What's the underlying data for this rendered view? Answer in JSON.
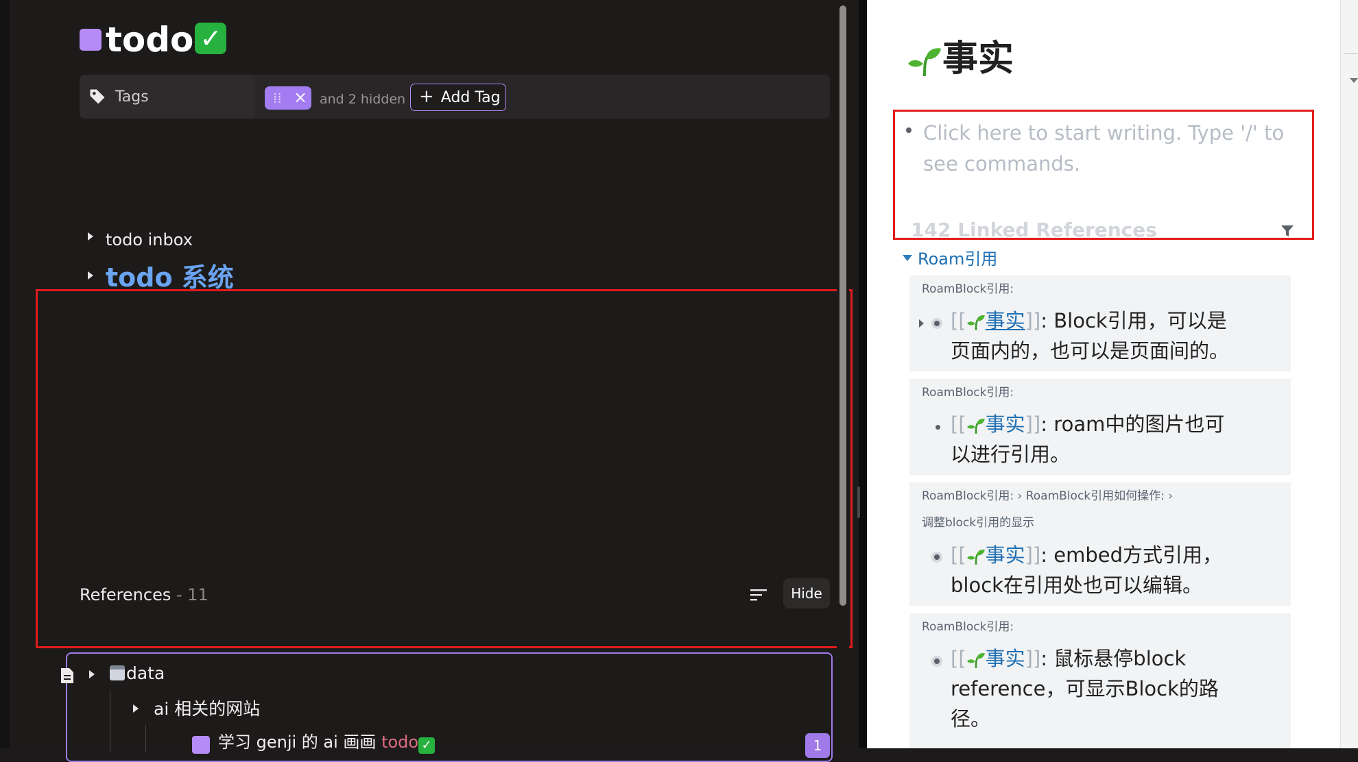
{
  "left": {
    "title": "todo",
    "title_check": "✓",
    "tags": {
      "label": "Tags",
      "chip_text": "⁞⁞",
      "chip_close": "×",
      "hidden_text": "and 2 hidden",
      "add_plus": "+",
      "add_label": "Add Tag"
    },
    "items": [
      {
        "label": "todo inbox"
      },
      {
        "label": "todo 系统"
      }
    ],
    "references": {
      "label": "References",
      "count": " - 11",
      "hide_label": "Hide"
    },
    "ref_card": {
      "root_label": "data",
      "child_label": "ai 相关的网站",
      "leaf_label": "学习 genji 的 ai 画画",
      "leaf_tag": "todo",
      "leaf_check": "✓",
      "badge": "1"
    }
  },
  "right": {
    "title": "事实",
    "placeholder": "Click here to start writing. Type '/' to see commands.",
    "linked_refs": "142 Linked References",
    "group": "Roam引用",
    "cards": [
      {
        "crumb": "RoamBlock引用:",
        "crumb2": "",
        "open": "[[",
        "link": "事实",
        "close": "]]",
        "text": ": Block引用，可以是页面内的，也可以是页面间的。"
      },
      {
        "crumb": "RoamBlock引用:",
        "crumb2": "",
        "open": "[[",
        "link": "事实",
        "close": "]]",
        "text": ": roam中的图片也可以进行引用。"
      },
      {
        "crumb": "RoamBlock引用:  ›  RoamBlock引用如何操作:  ›",
        "crumb2": "调整block引用的显示",
        "open": "[[",
        "link": "事实",
        "close": "]]",
        "text": ": embed方式引用，block在引用处也可以编辑。"
      },
      {
        "crumb": "RoamBlock引用:",
        "crumb2": "",
        "open": "[[",
        "link": "事实",
        "close": "]]",
        "text": ": 鼠标悬停block reference，可显示Block的路径。"
      }
    ]
  },
  "colors": {
    "accent_purple": "#b48bf7",
    "link_blue": "#1f6fb2",
    "highlight_red": "#e31b1b",
    "check_green": "#27b13f"
  }
}
